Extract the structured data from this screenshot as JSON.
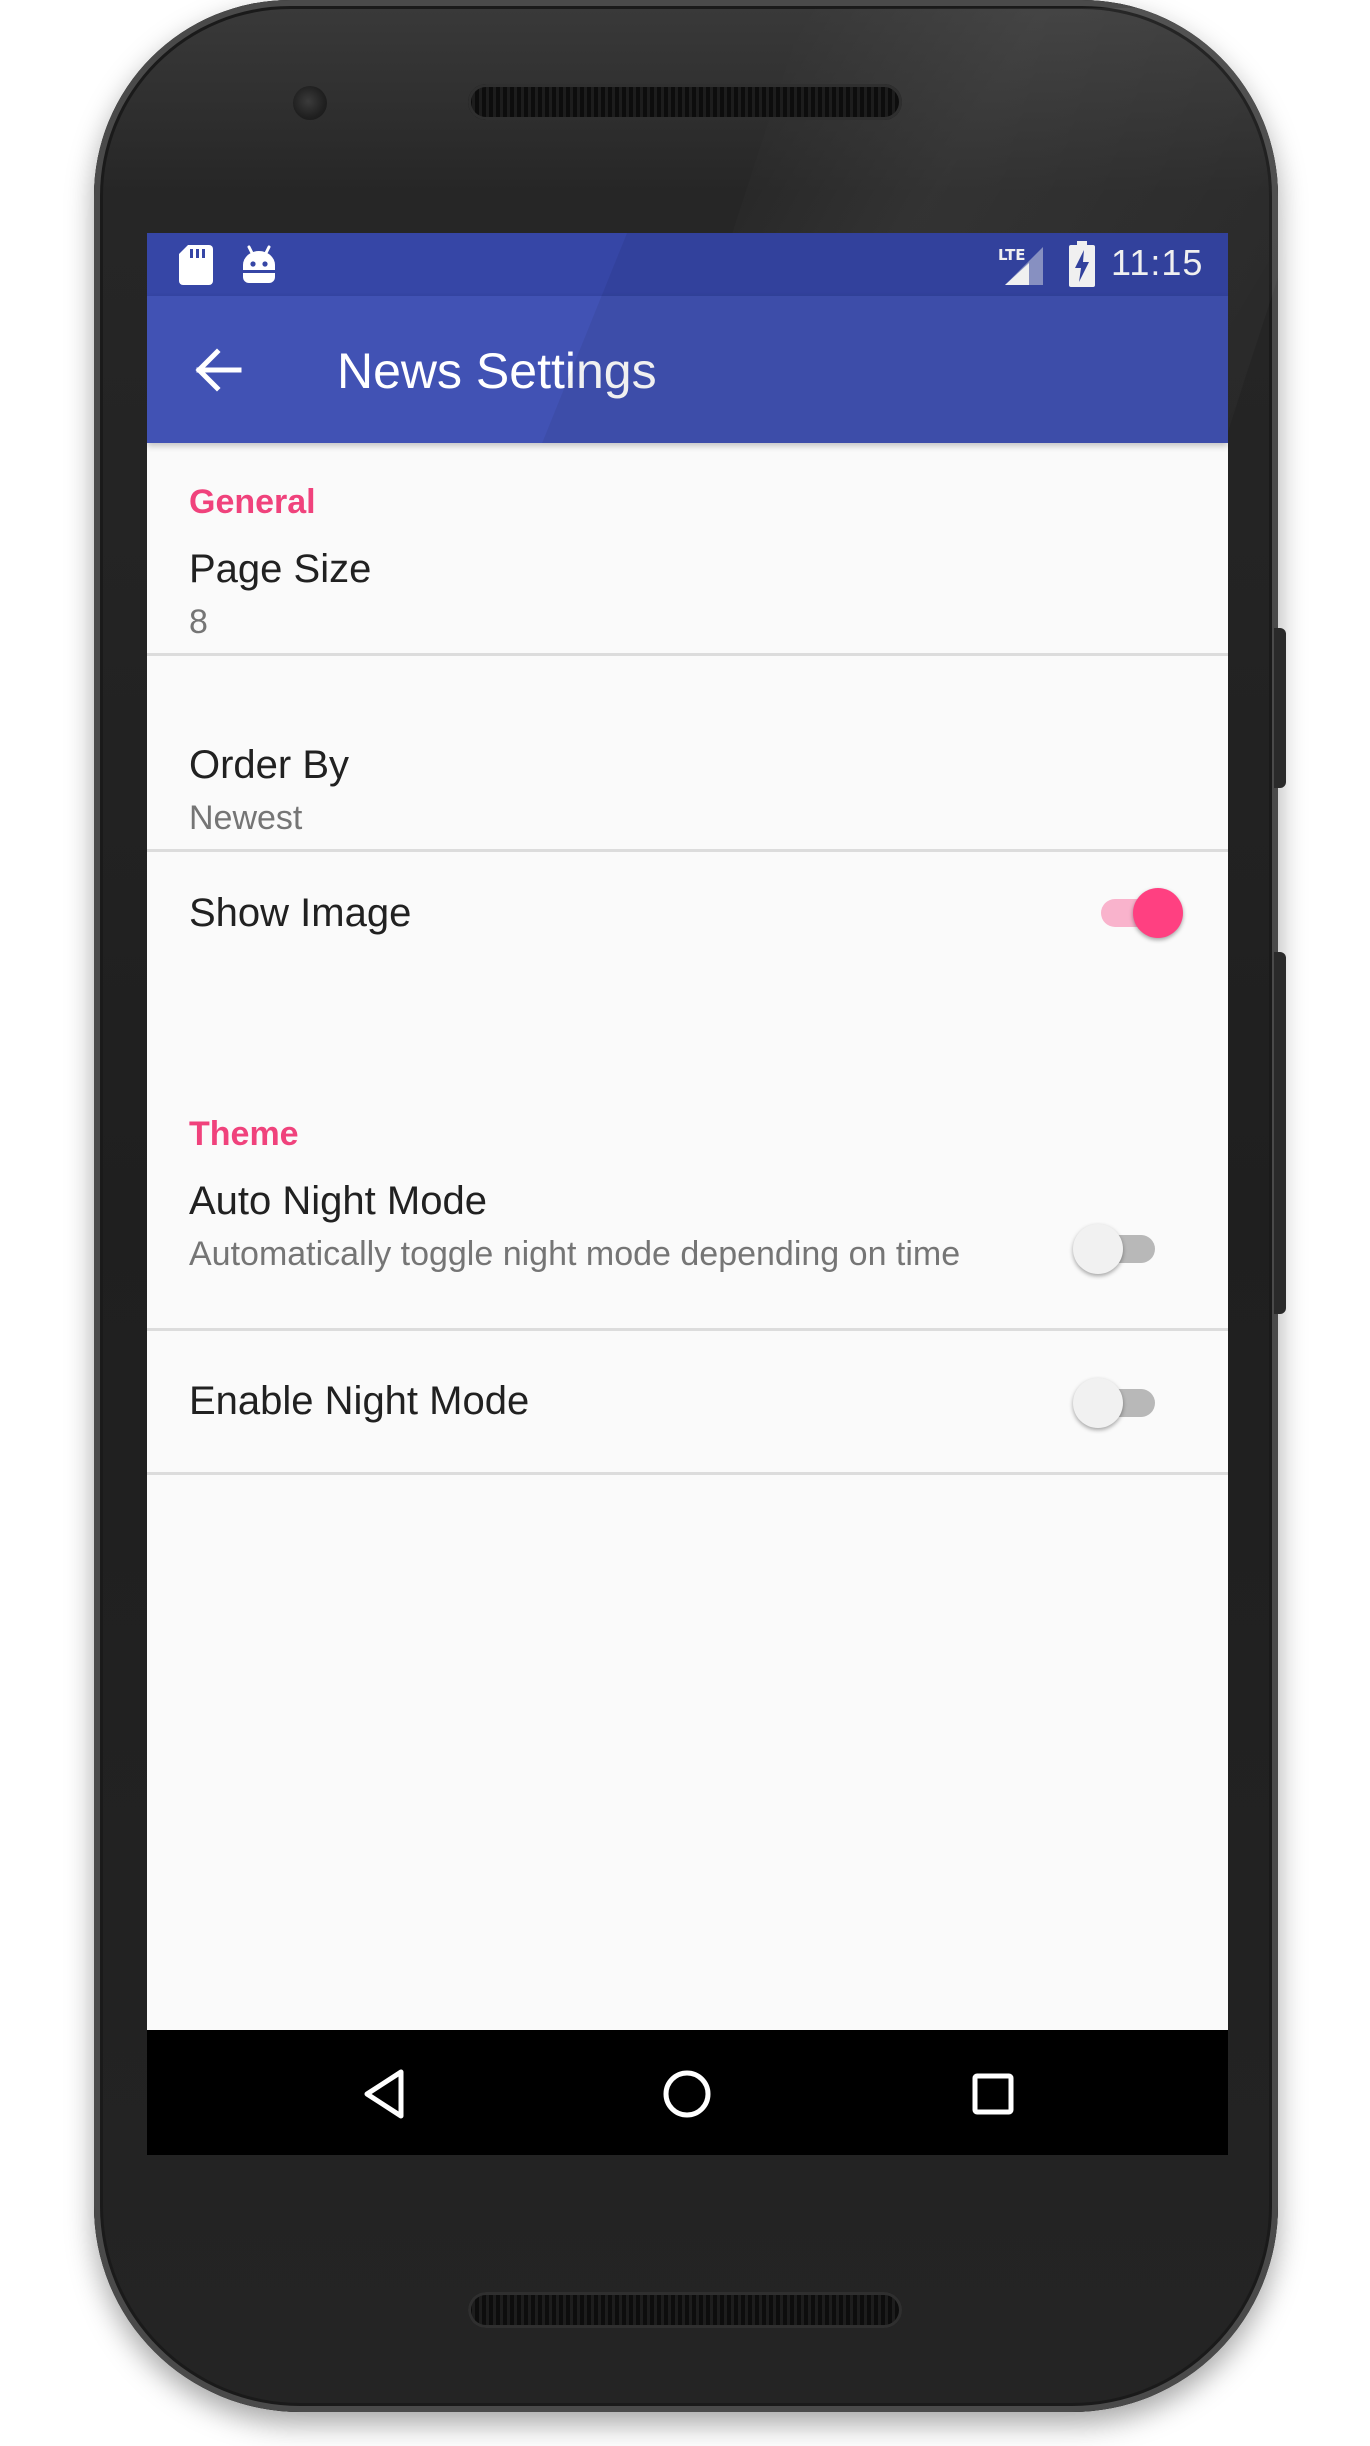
{
  "status_bar": {
    "time": "11:15",
    "left_icons": [
      "sd-card-icon",
      "android-debug-icon"
    ],
    "right_icons": [
      "lte-signal-icon",
      "battery-charging-icon"
    ]
  },
  "app_bar": {
    "title": "News Settings",
    "navigation_icon": "arrow-back-icon"
  },
  "preferences": {
    "general": {
      "header": "General",
      "page_size": {
        "title": "Page Size",
        "summary": "8"
      },
      "order_by": {
        "title": "Order By",
        "summary": "Newest"
      },
      "show_image": {
        "title": "Show Image",
        "checked": true
      }
    },
    "theme": {
      "header": "Theme",
      "auto_night_mode": {
        "title": "Auto Night Mode",
        "summary": "Automatically toggle night mode depending on time",
        "checked": false
      },
      "enable_night_mode": {
        "title": "Enable Night Mode",
        "checked": false
      }
    }
  },
  "nav_bar": {
    "buttons": [
      "back-triangle-icon",
      "home-circle-icon",
      "recents-square-icon"
    ]
  },
  "colors": {
    "primary": "#4152b4",
    "primary_dark": "#3646a6",
    "accent": "#ff4081",
    "category_text": "#f0427c"
  }
}
